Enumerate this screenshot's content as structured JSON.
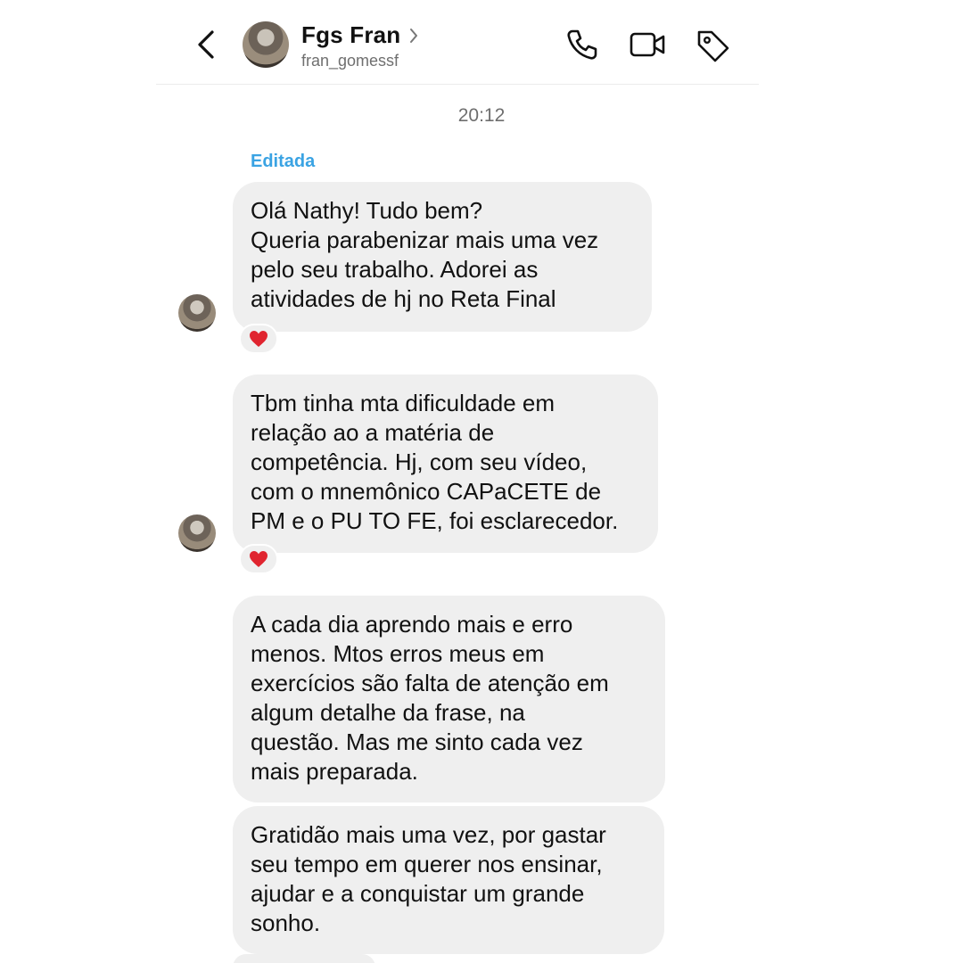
{
  "header": {
    "name": "Fgs Fran",
    "username": "fran_gomessf",
    "icons": [
      "back-arrow-icon",
      "chevron-right-icon",
      "phone-icon",
      "video-camera-icon",
      "tag-icon"
    ]
  },
  "chat": {
    "timestamp": "20:12",
    "edited_label": "Editada",
    "messages": [
      {
        "lines": [
          "Olá Nathy! Tudo bem?",
          "Queria parabenizar mais uma vez",
          "pelo seu trabalho. Adorei as",
          "atividades de hj no Reta Final"
        ],
        "reaction": "❤️"
      },
      {
        "lines": [
          "Tbm tinha mta dificuldade em",
          "relação ao a matéria de",
          "competência. Hj, com seu vídeo,",
          "com o mnemônico CAPaCETE de",
          "PM e o PU TO FE, foi esclarecedor."
        ],
        "reaction": "❤️"
      },
      {
        "lines": [
          "A cada dia aprendo mais e erro",
          "menos. Mtos erros meus em",
          "exercícios são falta de atenção em",
          "algum detalhe da frase, na",
          "questão. Mas me sinto cada vez",
          "mais preparada."
        ]
      },
      {
        "lines": [
          "Gratidão mais uma vez, por gastar",
          "seu tempo em querer nos ensinar,",
          "ajudar e a conquistar um grande",
          "sonho."
        ]
      }
    ]
  },
  "colors": {
    "bubble": "#efefef",
    "edited": "#3aa3e3",
    "heart": "#e0242f"
  }
}
